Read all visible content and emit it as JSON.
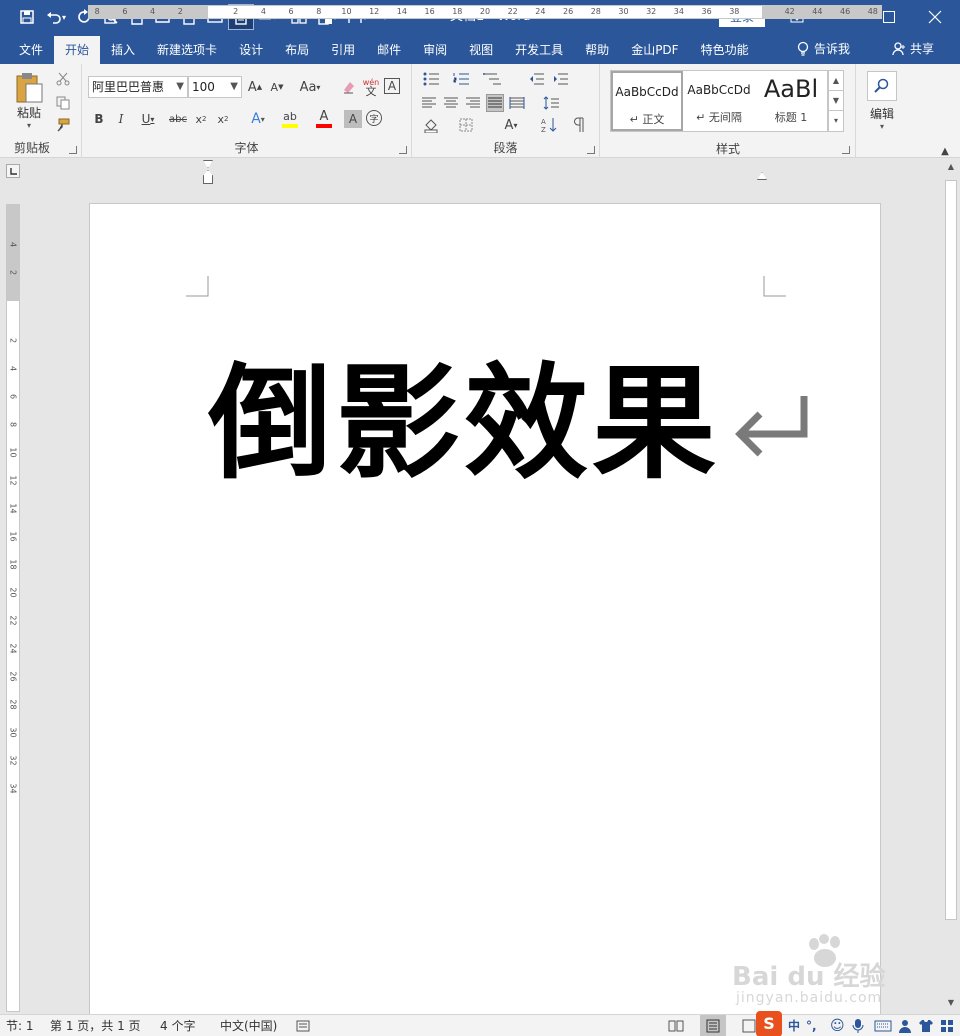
{
  "window": {
    "title": "文档1  -  Word",
    "login_label": "登录"
  },
  "ribbon_tabs": [
    "文件",
    "开始",
    "插入",
    "新建选项卡",
    "设计",
    "布局",
    "引用",
    "邮件",
    "审阅",
    "视图",
    "开发工具",
    "帮助",
    "金山PDF",
    "特色功能"
  ],
  "active_tab": "开始",
  "tell_me": "告诉我",
  "share": "共享",
  "clipboard": {
    "paste_label": "粘贴",
    "group_label": "剪贴板"
  },
  "font": {
    "name": "阿里巴巴普惠",
    "size": "100",
    "group_label": "字体",
    "phonetic_top": "wén",
    "phonetic_bottom": "文",
    "case_label": "Aa"
  },
  "paragraph": {
    "group_label": "段落"
  },
  "styles": {
    "group_label": "样式",
    "items": [
      {
        "sample": "AaBbCcDd",
        "name": "↵ 正文"
      },
      {
        "sample": "AaBbCcDd",
        "name": "↵ 无间隔"
      },
      {
        "sample": "AaBl",
        "name": "标题 1"
      }
    ]
  },
  "editing": {
    "label": "编辑"
  },
  "ruler": {
    "h_left_numbers": [
      "8",
      "6",
      "4",
      "2"
    ],
    "h_numbers": [
      "2",
      "4",
      "6",
      "8",
      "10",
      "12",
      "14",
      "16",
      "18",
      "20",
      "22",
      "24",
      "26",
      "28",
      "30",
      "32",
      "34",
      "36",
      "38"
    ],
    "h_right_numbers": [
      "42",
      "44",
      "46",
      "48"
    ],
    "v_top_numbers": [
      "4",
      "2"
    ],
    "v_numbers": [
      "2",
      "4",
      "6",
      "8",
      "10",
      "12",
      "14",
      "16",
      "18",
      "20",
      "22",
      "24",
      "26",
      "28",
      "30",
      "32",
      "34"
    ]
  },
  "document": {
    "text": "倒影效果"
  },
  "status": {
    "section": "节: 1",
    "page": "第 1 页，共 1 页",
    "words": "4 个字",
    "language": "中文(中国)"
  },
  "ime": {
    "mode": "中"
  },
  "watermark": {
    "brand": "Bai du 经验",
    "url": "jingyan.baidu.com"
  },
  "colors": {
    "title_bar": "#2b579a",
    "ribbon": "#f3f3f3",
    "canvas": "#e6e6e6",
    "highlight": "#ffff00",
    "font_color": "#ff0000"
  }
}
